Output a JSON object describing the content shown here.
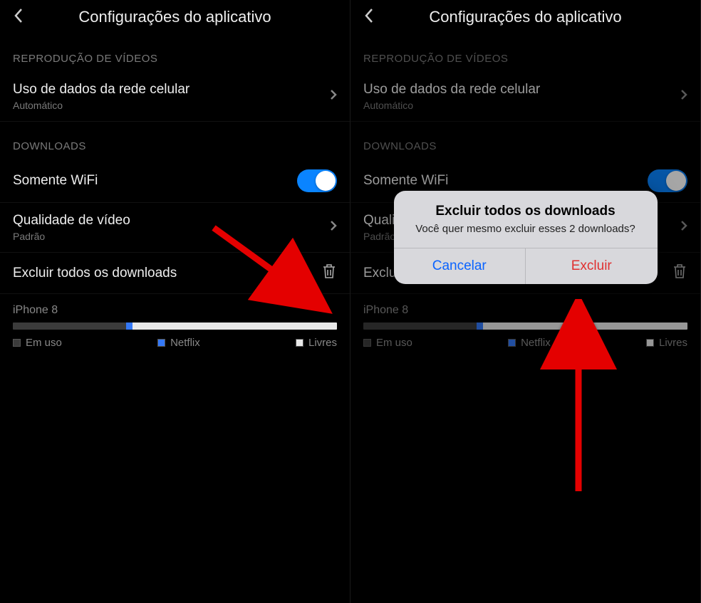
{
  "header": {
    "title": "Configurações do aplicativo"
  },
  "sections": {
    "video": {
      "header": "REPRODUÇÃO DE VÍDEOS",
      "cellular": {
        "title": "Uso de dados da rede celular",
        "sub": "Automático"
      }
    },
    "downloads": {
      "header": "DOWNLOADS",
      "wifi_only": {
        "title": "Somente WiFi",
        "on": true
      },
      "quality": {
        "title": "Qualidade de vídeo",
        "sub": "Padrão"
      },
      "delete_all": {
        "title": "Excluir todos os downloads"
      }
    }
  },
  "storage": {
    "device": "iPhone 8",
    "segments": {
      "used_pct": 35,
      "netflix_pct": 2,
      "free_pct": 63
    },
    "legend": {
      "used": "Em uso",
      "netflix": "Netflix",
      "free": "Livres"
    }
  },
  "alert": {
    "title": "Excluir todos os downloads",
    "message": "Você quer mesmo excluir esses 2 downloads?",
    "cancel": "Cancelar",
    "confirm": "Excluir"
  },
  "colors": {
    "accent": "#0a84ff",
    "destructive": "#e03030",
    "link": "#0a63ff"
  }
}
